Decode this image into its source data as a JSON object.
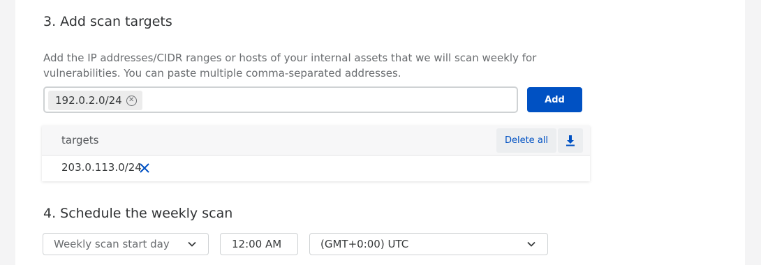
{
  "section3": {
    "heading": "3. Add scan targets",
    "description": "Add the IP addresses/CIDR ranges or hosts of your internal assets that we will scan weekly for vulnerabilities. You can paste multiple comma-separated addresses.",
    "chip_value": "192.0.2.0/24",
    "add_label": "Add"
  },
  "targets_table": {
    "header": "targets",
    "delete_all_label": "Delete all",
    "rows": [
      {
        "value": "203.0.113.0/24"
      }
    ]
  },
  "section4": {
    "heading": "4. Schedule the weekly scan",
    "day_select": "Weekly scan start day",
    "time_value": "12:00 AM",
    "timezone_select": "(GMT+0:00) UTC"
  },
  "colors": {
    "accent": "#0051c3",
    "background": "#f4f4f5"
  }
}
